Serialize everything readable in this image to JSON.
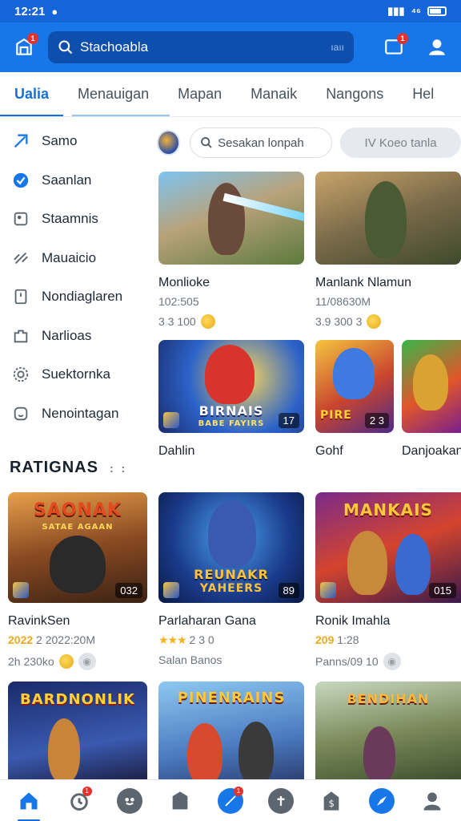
{
  "status_bar": {
    "time": "12:21",
    "signal_text": "⁴⁶"
  },
  "app_bar": {
    "search_placeholder": "Stachoabla",
    "search_code": "ıaıı",
    "badge_left": "1",
    "badge_right": "1"
  },
  "tabs": [
    "Ualia",
    "Menauigan",
    "Mapan",
    "Manaik",
    "Nangons",
    "Hel"
  ],
  "sidebar": {
    "items": [
      {
        "label": "Samo",
        "icon": "feather-icon"
      },
      {
        "label": "Saanlan",
        "icon": "check-badge-icon"
      },
      {
        "label": "Staamnis",
        "icon": "square-dot-icon"
      },
      {
        "label": "Mauaicio",
        "icon": "link-icon"
      },
      {
        "label": "Nondiaglaren",
        "icon": "document-icon"
      },
      {
        "label": "Narlioas",
        "icon": "puzzle-icon"
      },
      {
        "label": "Suektornka",
        "icon": "gear-icon"
      },
      {
        "label": "Nenointagan",
        "icon": "smile-icon"
      }
    ]
  },
  "filter": {
    "search_placeholder": "Sesakan lonpah",
    "chip_label": "IV Koeo tanla"
  },
  "top_cards": [
    {
      "title": "Monlioke",
      "sub": "102:505",
      "meta": "3 3 100"
    },
    {
      "title": "Manlank Nlamun",
      "sub": "11/08630M",
      "meta": "3.9 300 3"
    }
  ],
  "mid_cards": [
    {
      "title": "Dahlin",
      "art_text": "BIRNAIS",
      "art_sub": "BABE FAYIRS",
      "count": "17"
    },
    {
      "title": "Gohf",
      "art_text": "PIRE",
      "count": "2 3"
    },
    {
      "title": "Danjoakan",
      "art_text": "",
      "count": ""
    }
  ],
  "section": {
    "title": "RATIGNAS",
    "dots": ":"
  },
  "rating_cards": [
    {
      "title": "RavinkSen",
      "gold": "2022",
      "sub": "2 2022:20M",
      "meta": "2h 230ko",
      "art_text": "SAONAK",
      "art_sub": "SATAE AGAAN",
      "count": "032"
    },
    {
      "title": "Parlaharan Gana",
      "stars": "★★★",
      "sub": "2 3 0",
      "meta": "Salan Banos",
      "art_text": "REUNAKR",
      "art_sub": "YAHEERS",
      "count": "89"
    },
    {
      "title": "Ronik Imahla",
      "gold": "209",
      "sub": "1:28",
      "meta": "Panns/09 10",
      "art_text": "MANKAIS",
      "art_sub": "",
      "count": "015"
    }
  ],
  "bottom_cards": [
    {
      "art_text": "BARDNONLIK"
    },
    {
      "art_text": "PINENRAINS"
    },
    {
      "art_text": "BENDIHAN"
    }
  ],
  "bottom_nav": {
    "items": [
      "home-icon",
      "alarm-icon",
      "emoji-icon",
      "shield-icon",
      "pencil-icon",
      "tool-icon",
      "bag-icon",
      "compass-icon",
      "profile-icon"
    ],
    "badges": {
      "alarm": "1",
      "pencil": "1"
    }
  },
  "colors": {
    "primary": "#1877e8",
    "status": "#1565d8",
    "accent_text": "#1670d8",
    "badge": "#e5322d",
    "gold": "#f0a81c"
  }
}
